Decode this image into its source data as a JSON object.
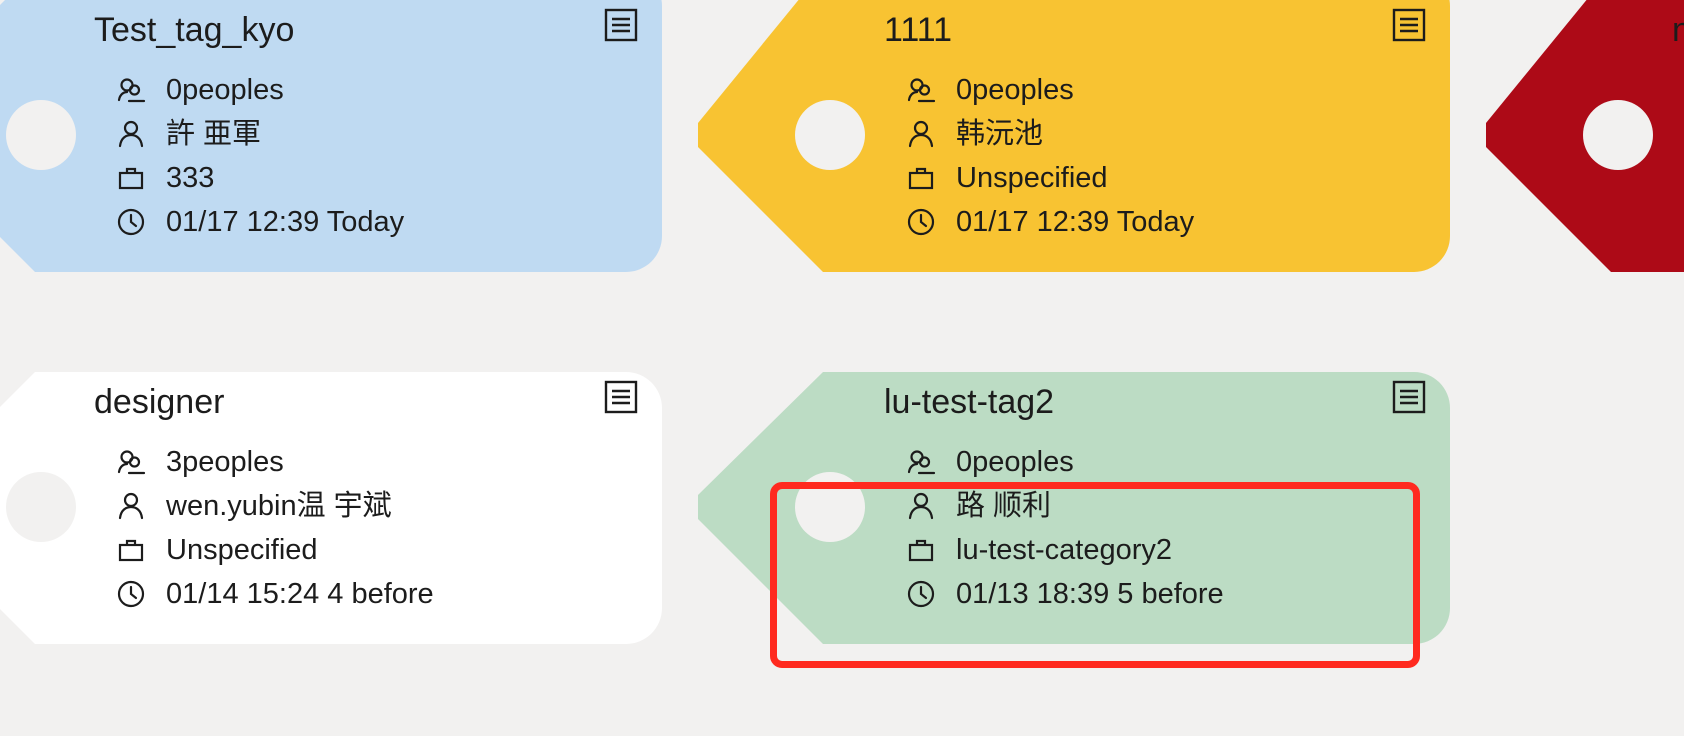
{
  "cards": [
    {
      "name": "Test_tag_kyo",
      "color": "#bfdaf2",
      "people_count": "0peoples",
      "owner": "許 亜軍",
      "category": "333",
      "time": "01/17 12:39 Today"
    },
    {
      "name": "1111",
      "color": "#f8c332",
      "people_count": "0peoples",
      "owner": "韩沅池",
      "category": "Unspecified",
      "time": "01/17 12:39 Today"
    },
    {
      "name": "n",
      "color": "#ad0a17"
    },
    {
      "name": "designer",
      "color": "#ffffff",
      "people_count": "3peoples",
      "owner": "wen.yubin温 宇斌",
      "category": "Unspecified",
      "time": "01/14 15:24 4 before"
    },
    {
      "name": "lu-test-tag2",
      "color": "#bcdcc4",
      "people_count": "0peoples",
      "owner": "路 顺利",
      "category": "lu-test-category2",
      "time": "01/13 18:39 5 before"
    }
  ],
  "colors": {
    "background": "#f2f1f0",
    "hole": "#f2f1f0",
    "highlight": "#ff2a1f",
    "text": "#1c1c1c"
  },
  "icons": {
    "people": "people-icon",
    "owner": "person-icon",
    "category": "briefcase-icon",
    "time": "clock-icon",
    "menu": "list-icon"
  }
}
